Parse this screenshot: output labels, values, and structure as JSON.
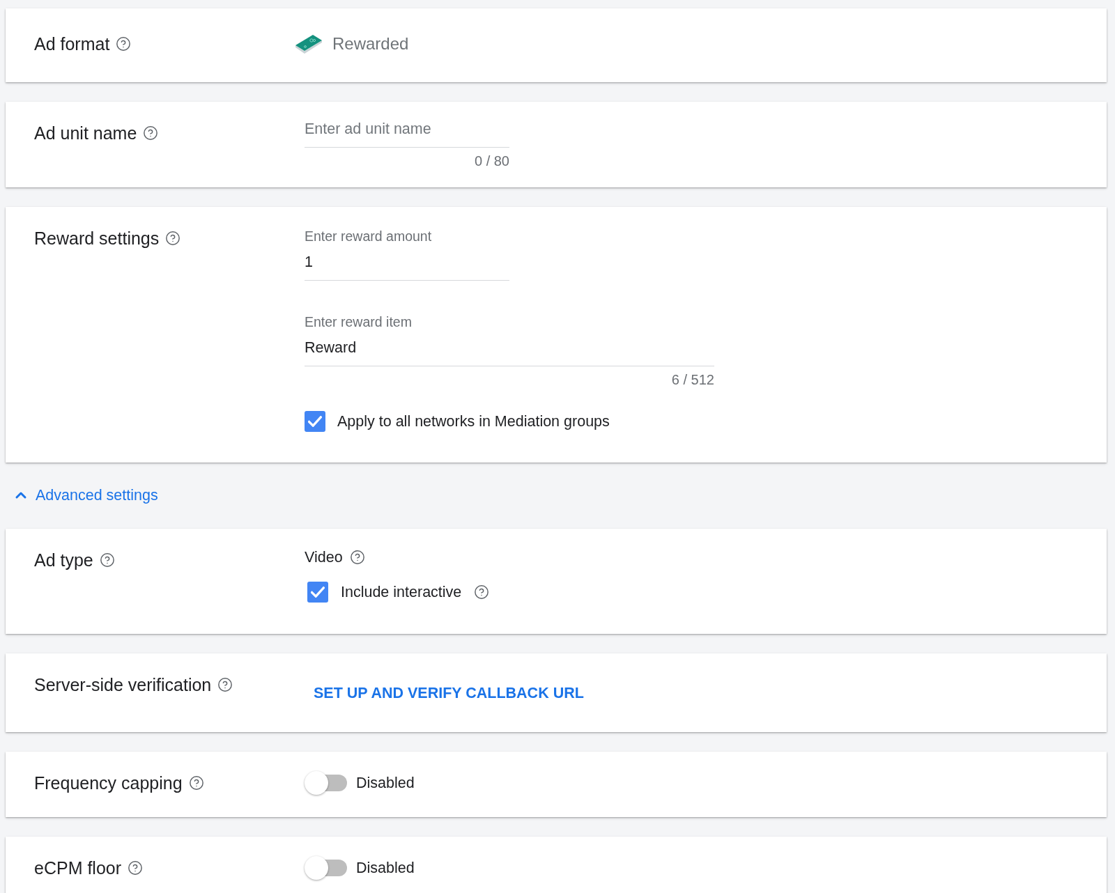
{
  "sections": [
    {
      "kind": "format",
      "label": "Ad format",
      "value": "Rewarded"
    },
    {
      "kind": "text_field",
      "label": "Ad unit name",
      "placeholder": "Enter ad unit name",
      "counter": "0 / 80"
    },
    {
      "kind": "reward",
      "label": "Reward settings",
      "fields": [
        {
          "label": "Enter reward amount",
          "value": "1"
        },
        {
          "label": "Enter reward item",
          "value": "Reward",
          "counter": "6 / 512"
        }
      ],
      "checkbox": {
        "label": "Apply to all networks in Mediation groups",
        "checked": true
      }
    }
  ],
  "advanced": {
    "label": "Advanced settings",
    "expanded": true
  },
  "advanced_sections": [
    {
      "kind": "ad_type",
      "label": "Ad type",
      "option": "Video",
      "checkbox": {
        "label": "Include interactive",
        "checked": true
      }
    },
    {
      "kind": "link",
      "label": "Server-side verification",
      "link": "SET UP AND VERIFY CALLBACK URL"
    },
    {
      "kind": "toggle",
      "label": "Frequency capping",
      "on": false,
      "status": "Disabled"
    },
    {
      "kind": "toggle",
      "label": "eCPM floor",
      "on": false,
      "status": "Disabled"
    }
  ]
}
